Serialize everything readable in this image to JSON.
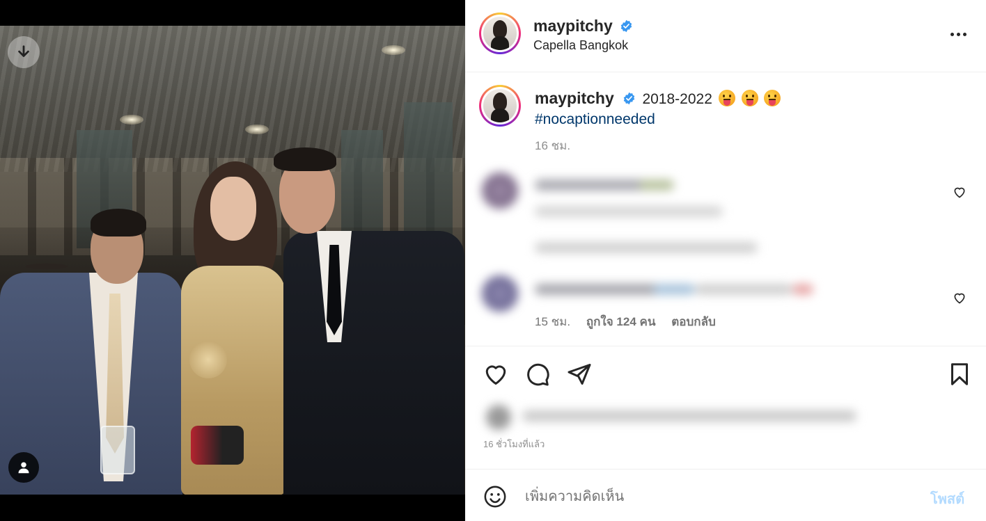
{
  "post": {
    "username": "maypitchy",
    "verified": true,
    "location": "Capella Bangkok",
    "caption_text": "2018-2022",
    "caption_emojis": [
      "😛",
      "😛",
      "😛"
    ],
    "hashtag": "#nocaptionneeded",
    "caption_time": "16 ชม.",
    "date_line": "16 ชั่วโมงที่แล้ว"
  },
  "comments": {
    "meta_time": "15 ชม.",
    "meta_likes": "ถูกใจ 124 คน",
    "meta_reply": "ตอบกลับ"
  },
  "media": {
    "download_icon": "arrow-down-icon",
    "tagged_icon": "user-icon"
  },
  "actions": {
    "icons": [
      "heart-icon",
      "comment-icon",
      "share-icon",
      "bookmark-icon"
    ]
  },
  "composer": {
    "placeholder": "เพิ่มความคิดเห็น",
    "post_label": "โพสต์"
  },
  "colors": {
    "verified": "#3897f0",
    "hashtag": "#00376b",
    "post_disabled": "#b3dbff",
    "secondary_text": "#8e8e8e"
  }
}
